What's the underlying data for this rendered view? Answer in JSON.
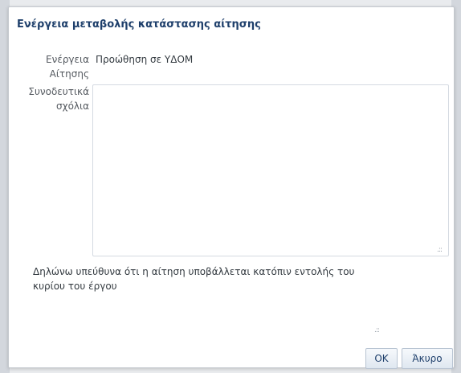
{
  "dialog": {
    "title": "Ενέργεια μεταβολής κατάστασης αίτησης",
    "fields": {
      "action_label_line1": "Ενέργεια",
      "action_label_line2": "Αίτησης",
      "action_value": "Προώθηση σε ΥΔΟΜ",
      "comments_label_line1": "Συνοδευτικά",
      "comments_label_line2": "σχόλια",
      "comments_value": ""
    },
    "declaration_line1": "Δηλώνω υπεύθυνα ότι η αίτηση υποβάλλεται κατόπιν εντολής του",
    "declaration_line2": "κυρίου του έργου",
    "buttons": {
      "ok": "OK",
      "cancel": "Άκυρο"
    }
  }
}
